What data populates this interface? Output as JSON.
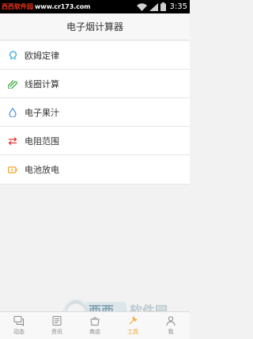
{
  "status_bar": {
    "watermark_brand": "西西软件园",
    "watermark_url": "www.cr173.com",
    "time": "3:35"
  },
  "header": {
    "title": "电子烟计算器"
  },
  "menu": {
    "items": [
      {
        "label": "欧姆定律",
        "icon": "omega-icon",
        "color": "#29a3d8"
      },
      {
        "label": "线圈计算",
        "icon": "paperclip-icon",
        "color": "#4caf50"
      },
      {
        "label": "电子果汁",
        "icon": "drop-icon",
        "color": "#4a90d9"
      },
      {
        "label": "电阻范围",
        "icon": "swap-arrows-icon",
        "color": "#e53935"
      },
      {
        "label": "电池放电",
        "icon": "battery-icon",
        "color": "#f0a22a"
      }
    ]
  },
  "tabs": [
    {
      "label": "动态",
      "icon": "chat-icon",
      "active": false
    },
    {
      "label": "资讯",
      "icon": "news-icon",
      "active": false
    },
    {
      "label": "商店",
      "icon": "store-icon",
      "active": false
    },
    {
      "label": "工具",
      "icon": "tools-icon",
      "active": true
    },
    {
      "label": "我",
      "icon": "user-icon",
      "active": false
    }
  ],
  "watermark": {
    "logo_text": "西西软件园",
    "logo_url": "CR173.COM"
  },
  "colors": {
    "accent": "#f0a22a"
  }
}
